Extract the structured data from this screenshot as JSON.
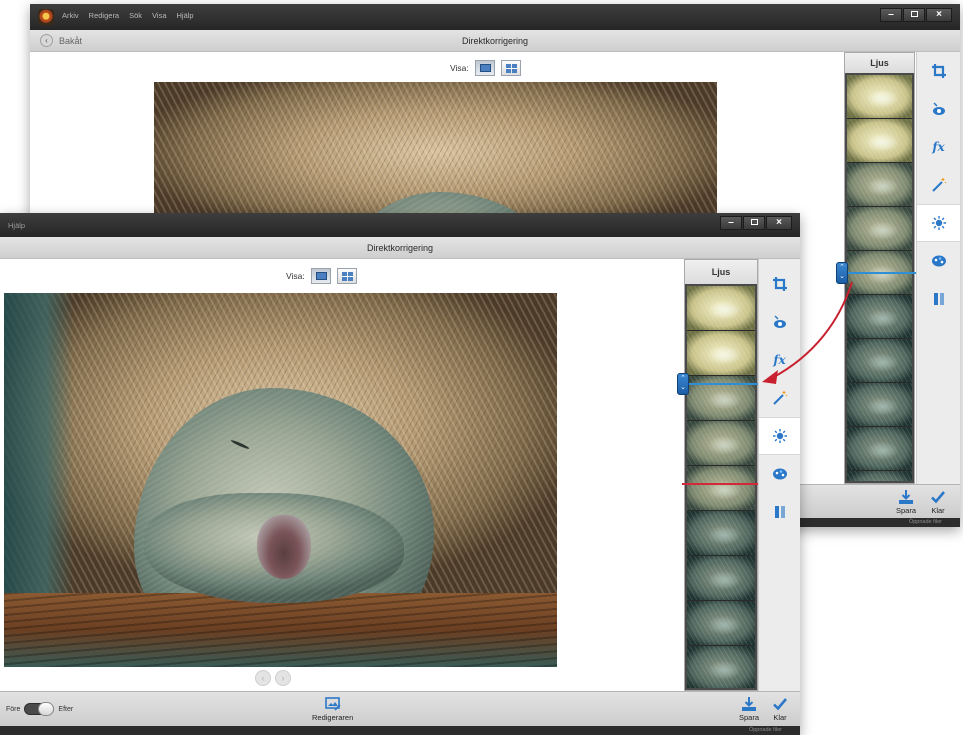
{
  "back_window": {
    "menu": [
      "Arkiv",
      "Redigera",
      "Sök",
      "Visa",
      "Hjälp"
    ],
    "back_label": "Bakåt",
    "title": "Direktkorrigering",
    "view_label": "Visa:",
    "panel_title": "Ljus",
    "save_label": "Spara",
    "done_label": "Klar",
    "status_text": "Öppnade filer"
  },
  "front_window": {
    "menu_fragment": "Hjälp",
    "title": "Direktkorrigering",
    "view_label": "Visa:",
    "panel_title": "Ljus",
    "before_label": "Före",
    "after_label": "Efter",
    "editor_label": "Redigeraren",
    "save_label": "Spara",
    "done_label": "Klar",
    "status_text": "Öppnade filer"
  },
  "window_controls": [
    "minimize",
    "maximize",
    "close"
  ],
  "tools": [
    "crop-icon",
    "red-eye-icon",
    "effects-icon",
    "magic-wand-icon",
    "light-icon",
    "color-icon",
    "sharpen-icon"
  ],
  "active_tool": "light-icon",
  "colors": {
    "accent": "#2b78c8",
    "highlight_red": "#d1283a",
    "titlebar": "#2e2e2e"
  }
}
